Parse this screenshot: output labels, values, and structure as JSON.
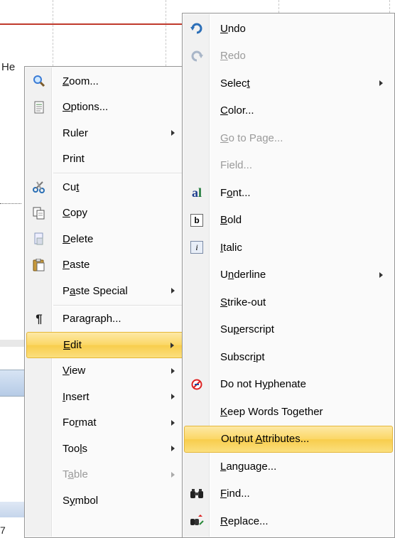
{
  "document": {
    "hello_fragment": "He",
    "bottom_fragment": "7"
  },
  "context_menu": {
    "items": [
      {
        "label": "Zoom...",
        "icon": "zoom-icon",
        "submenu": false,
        "enabled": true
      },
      {
        "label": "Options...",
        "icon": "options-icon",
        "submenu": false,
        "enabled": true
      },
      {
        "label": "Ruler",
        "icon": "",
        "submenu": true,
        "enabled": true
      },
      {
        "label": "Print",
        "icon": "",
        "submenu": false,
        "enabled": true
      },
      {
        "label": "Cut",
        "icon": "scissors-icon",
        "submenu": false,
        "enabled": true
      },
      {
        "label": "Copy",
        "icon": "copy-icon",
        "submenu": false,
        "enabled": true
      },
      {
        "label": "Delete",
        "icon": "delete-icon",
        "submenu": false,
        "enabled": true
      },
      {
        "label": "Paste",
        "icon": "paste-icon",
        "submenu": false,
        "enabled": true
      },
      {
        "label": "Paste Special",
        "icon": "",
        "submenu": true,
        "enabled": true
      },
      {
        "label": "Paragraph...",
        "icon": "pilcrow-icon",
        "submenu": false,
        "enabled": true
      },
      {
        "label": "Edit",
        "icon": "",
        "submenu": true,
        "enabled": true,
        "highlighted": true
      },
      {
        "label": "View",
        "icon": "",
        "submenu": true,
        "enabled": true
      },
      {
        "label": "Insert",
        "icon": "",
        "submenu": true,
        "enabled": true
      },
      {
        "label": "Format",
        "icon": "",
        "submenu": true,
        "enabled": true
      },
      {
        "label": "Tools",
        "icon": "",
        "submenu": true,
        "enabled": true
      },
      {
        "label": "Table",
        "icon": "",
        "submenu": true,
        "enabled": false
      },
      {
        "label": "Symbol",
        "icon": "",
        "submenu": false,
        "enabled": true
      }
    ]
  },
  "edit_submenu": {
    "items": [
      {
        "label": "Undo",
        "icon": "undo-icon",
        "submenu": false,
        "enabled": true
      },
      {
        "label": "Redo",
        "icon": "redo-icon",
        "submenu": false,
        "enabled": false
      },
      {
        "label": "Select",
        "icon": "",
        "submenu": true,
        "enabled": true
      },
      {
        "label": "Color...",
        "icon": "",
        "submenu": false,
        "enabled": true
      },
      {
        "label": "Go to Page...",
        "icon": "",
        "submenu": false,
        "enabled": false
      },
      {
        "label": "Field...",
        "icon": "",
        "submenu": false,
        "enabled": false
      },
      {
        "label": "Font...",
        "icon": "font-icon",
        "submenu": false,
        "enabled": true
      },
      {
        "label": "Bold",
        "icon": "bold-icon",
        "submenu": false,
        "enabled": true
      },
      {
        "label": "Italic",
        "icon": "italic-icon",
        "submenu": false,
        "enabled": true
      },
      {
        "label": "Underline",
        "icon": "",
        "submenu": true,
        "enabled": true
      },
      {
        "label": "Strike-out",
        "icon": "",
        "submenu": false,
        "enabled": true
      },
      {
        "label": "Superscript",
        "icon": "",
        "submenu": false,
        "enabled": true
      },
      {
        "label": "Subscript",
        "icon": "",
        "submenu": false,
        "enabled": true
      },
      {
        "label": "Do not Hyphenate",
        "icon": "no-hyphenate-icon",
        "submenu": false,
        "enabled": true
      },
      {
        "label": "Keep Words Together",
        "icon": "",
        "submenu": false,
        "enabled": true
      },
      {
        "label": "Output Attributes...",
        "icon": "",
        "submenu": false,
        "enabled": true,
        "highlighted": true
      },
      {
        "label": "Language...",
        "icon": "",
        "submenu": false,
        "enabled": true
      },
      {
        "label": "Find...",
        "icon": "binoculars-icon",
        "submenu": false,
        "enabled": true
      },
      {
        "label": "Replace...",
        "icon": "replace-icon",
        "submenu": false,
        "enabled": true
      }
    ]
  }
}
